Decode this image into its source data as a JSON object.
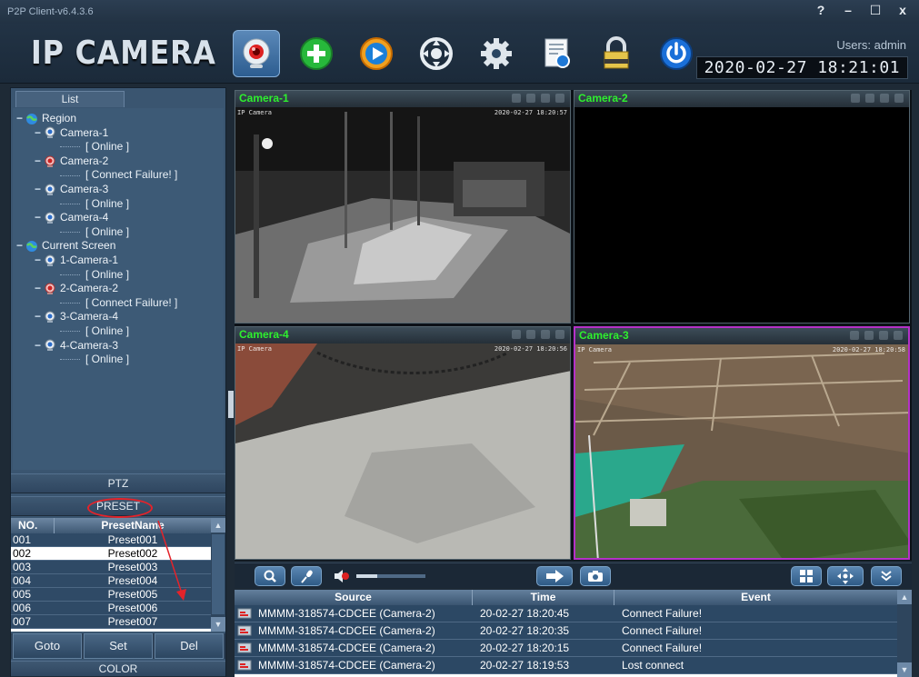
{
  "window": {
    "title": "P2P Client-v6.4.3.6",
    "controls": [
      "?",
      "–",
      "☐",
      "x"
    ]
  },
  "header": {
    "brand": "IP CAMERA",
    "users_label": "Users: admin",
    "datetime": "2020-02-27 18:21:01",
    "toolbar": [
      "camera",
      "add",
      "playback",
      "ptz",
      "settings",
      "log",
      "lock",
      "power"
    ]
  },
  "left": {
    "list_tab": "List",
    "tree": [
      {
        "indent": 0,
        "type": "group",
        "label": "Region"
      },
      {
        "indent": 1,
        "type": "camera-ok",
        "label": "Camera-1"
      },
      {
        "indent": 2,
        "type": "status",
        "label": "[ Online ]"
      },
      {
        "indent": 1,
        "type": "camera-fail",
        "label": "Camera-2"
      },
      {
        "indent": 2,
        "type": "status",
        "label": "[ Connect Failure! ]"
      },
      {
        "indent": 1,
        "type": "camera-ok",
        "label": "Camera-3"
      },
      {
        "indent": 2,
        "type": "status",
        "label": "[ Online ]"
      },
      {
        "indent": 1,
        "type": "camera-ok",
        "label": "Camera-4"
      },
      {
        "indent": 2,
        "type": "status",
        "label": "[ Online ]"
      },
      {
        "indent": 0,
        "type": "group",
        "label": "Current Screen"
      },
      {
        "indent": 1,
        "type": "camera-ok",
        "label": "1-Camera-1"
      },
      {
        "indent": 2,
        "type": "status",
        "label": "[ Online ]"
      },
      {
        "indent": 1,
        "type": "camera-fail",
        "label": "2-Camera-2"
      },
      {
        "indent": 2,
        "type": "status",
        "label": "[ Connect Failure! ]"
      },
      {
        "indent": 1,
        "type": "camera-ok",
        "label": "3-Camera-4"
      },
      {
        "indent": 2,
        "type": "status",
        "label": "[ Online ]"
      },
      {
        "indent": 1,
        "type": "camera-ok",
        "label": "4-Camera-3"
      },
      {
        "indent": 2,
        "type": "status",
        "label": "[ Online ]"
      }
    ],
    "ptz_label": "PTZ",
    "preset_label": "PRESET",
    "preset_table": {
      "headers": [
        "NO.",
        "PresetName"
      ],
      "rows": [
        [
          "001",
          "Preset001"
        ],
        [
          "002",
          "Preset002"
        ],
        [
          "003",
          "Preset003"
        ],
        [
          "004",
          "Preset004"
        ],
        [
          "005",
          "Preset005"
        ],
        [
          "006",
          "Preset006"
        ],
        [
          "007",
          "Preset007"
        ]
      ],
      "selected_index": 1
    },
    "buttons": {
      "goto": "Goto",
      "set": "Set",
      "del": "Del"
    },
    "color_label": "COLOR"
  },
  "cameras": [
    {
      "name": "Camera-1",
      "osd_left": "IP Camera",
      "osd_right": "2020-02-27 18:20:57",
      "scene": "night",
      "active": false
    },
    {
      "name": "Camera-2",
      "osd_left": "",
      "osd_right": "",
      "scene": "black",
      "active": false
    },
    {
      "name": "Camera-4",
      "osd_left": "IP Camera",
      "osd_right": "2020-02-27 18:20:56",
      "scene": "ground",
      "active": false
    },
    {
      "name": "Camera-3",
      "osd_left": "IP Camera",
      "osd_right": "2020-02-27 18:20:58",
      "scene": "aerial",
      "active": true
    }
  ],
  "controls": {
    "volume_level": 0.3
  },
  "events": {
    "headers": {
      "source": "Source",
      "time": "Time",
      "event": "Event"
    },
    "rows": [
      {
        "source": "MMMM-318574-CDCEE (Camera-2)",
        "time": "20-02-27 18:20:45",
        "event": "Connect Failure!"
      },
      {
        "source": "MMMM-318574-CDCEE (Camera-2)",
        "time": "20-02-27 18:20:35",
        "event": "Connect Failure!"
      },
      {
        "source": "MMMM-318574-CDCEE (Camera-2)",
        "time": "20-02-27 18:20:15",
        "event": "Connect Failure!"
      },
      {
        "source": "MMMM-318574-CDCEE (Camera-2)",
        "time": "20-02-27 18:19:53",
        "event": "Lost connect"
      }
    ]
  }
}
